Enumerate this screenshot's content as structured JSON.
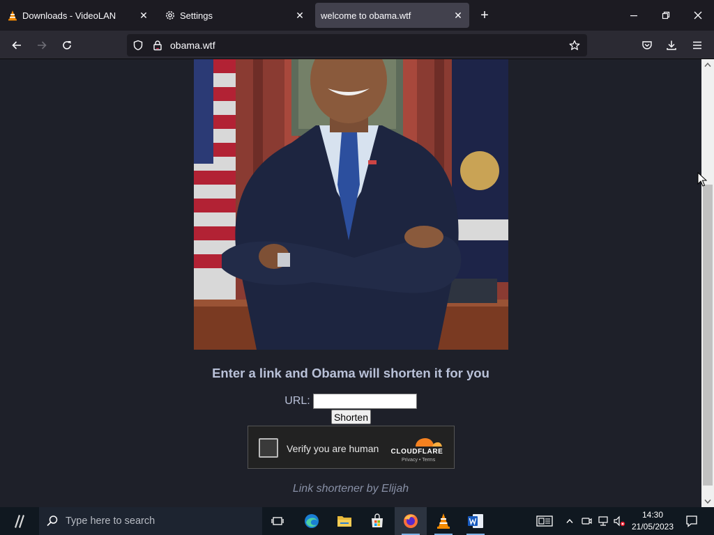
{
  "browser": {
    "tabs": [
      {
        "label": "Downloads - VideoLAN",
        "icon": "vlc-cone-icon",
        "active": false
      },
      {
        "label": "Settings",
        "icon": "gear-icon",
        "active": false
      },
      {
        "label": "welcome to obama.wtf",
        "icon": "",
        "active": true
      }
    ],
    "url": "obama.wtf"
  },
  "page": {
    "headline": "Enter a link and Obama will shorten it for you",
    "url_label": "URL:",
    "url_value": "",
    "shorten_label": "Shorten",
    "captcha": {
      "label": "Verify you are human",
      "brand": "CLOUDFLARE",
      "privacy": "Privacy",
      "separator": "•",
      "terms": "Terms"
    },
    "credit": "Link shortener by Elijah"
  },
  "taskbar": {
    "search_placeholder": "Type here to search",
    "time": "14:30",
    "date": "21/05/2023"
  },
  "colors": {
    "page_bg": "#1e2029",
    "headline": "#b9c1d8",
    "cloudflare_orange": "#f48120"
  }
}
